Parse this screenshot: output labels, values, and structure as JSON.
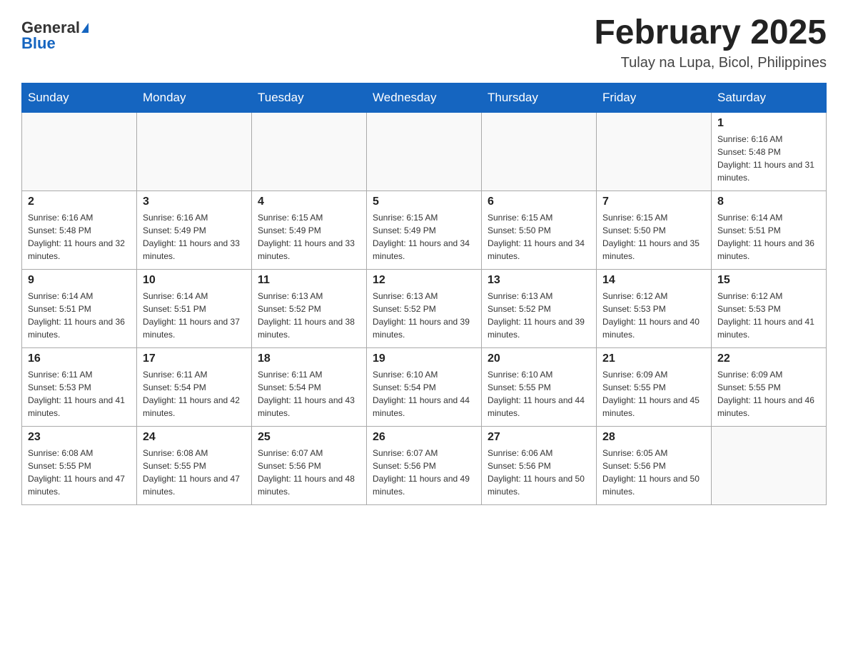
{
  "header": {
    "logo_general": "General",
    "logo_blue": "Blue",
    "month_title": "February 2025",
    "location": "Tulay na Lupa, Bicol, Philippines"
  },
  "days_of_week": [
    "Sunday",
    "Monday",
    "Tuesday",
    "Wednesday",
    "Thursday",
    "Friday",
    "Saturday"
  ],
  "weeks": [
    [
      {
        "day": "",
        "info": []
      },
      {
        "day": "",
        "info": []
      },
      {
        "day": "",
        "info": []
      },
      {
        "day": "",
        "info": []
      },
      {
        "day": "",
        "info": []
      },
      {
        "day": "",
        "info": []
      },
      {
        "day": "1",
        "info": [
          "Sunrise: 6:16 AM",
          "Sunset: 5:48 PM",
          "Daylight: 11 hours and 31 minutes."
        ]
      }
    ],
    [
      {
        "day": "2",
        "info": [
          "Sunrise: 6:16 AM",
          "Sunset: 5:48 PM",
          "Daylight: 11 hours and 32 minutes."
        ]
      },
      {
        "day": "3",
        "info": [
          "Sunrise: 6:16 AM",
          "Sunset: 5:49 PM",
          "Daylight: 11 hours and 33 minutes."
        ]
      },
      {
        "day": "4",
        "info": [
          "Sunrise: 6:15 AM",
          "Sunset: 5:49 PM",
          "Daylight: 11 hours and 33 minutes."
        ]
      },
      {
        "day": "5",
        "info": [
          "Sunrise: 6:15 AM",
          "Sunset: 5:49 PM",
          "Daylight: 11 hours and 34 minutes."
        ]
      },
      {
        "day": "6",
        "info": [
          "Sunrise: 6:15 AM",
          "Sunset: 5:50 PM",
          "Daylight: 11 hours and 34 minutes."
        ]
      },
      {
        "day": "7",
        "info": [
          "Sunrise: 6:15 AM",
          "Sunset: 5:50 PM",
          "Daylight: 11 hours and 35 minutes."
        ]
      },
      {
        "day": "8",
        "info": [
          "Sunrise: 6:14 AM",
          "Sunset: 5:51 PM",
          "Daylight: 11 hours and 36 minutes."
        ]
      }
    ],
    [
      {
        "day": "9",
        "info": [
          "Sunrise: 6:14 AM",
          "Sunset: 5:51 PM",
          "Daylight: 11 hours and 36 minutes."
        ]
      },
      {
        "day": "10",
        "info": [
          "Sunrise: 6:14 AM",
          "Sunset: 5:51 PM",
          "Daylight: 11 hours and 37 minutes."
        ]
      },
      {
        "day": "11",
        "info": [
          "Sunrise: 6:13 AM",
          "Sunset: 5:52 PM",
          "Daylight: 11 hours and 38 minutes."
        ]
      },
      {
        "day": "12",
        "info": [
          "Sunrise: 6:13 AM",
          "Sunset: 5:52 PM",
          "Daylight: 11 hours and 39 minutes."
        ]
      },
      {
        "day": "13",
        "info": [
          "Sunrise: 6:13 AM",
          "Sunset: 5:52 PM",
          "Daylight: 11 hours and 39 minutes."
        ]
      },
      {
        "day": "14",
        "info": [
          "Sunrise: 6:12 AM",
          "Sunset: 5:53 PM",
          "Daylight: 11 hours and 40 minutes."
        ]
      },
      {
        "day": "15",
        "info": [
          "Sunrise: 6:12 AM",
          "Sunset: 5:53 PM",
          "Daylight: 11 hours and 41 minutes."
        ]
      }
    ],
    [
      {
        "day": "16",
        "info": [
          "Sunrise: 6:11 AM",
          "Sunset: 5:53 PM",
          "Daylight: 11 hours and 41 minutes."
        ]
      },
      {
        "day": "17",
        "info": [
          "Sunrise: 6:11 AM",
          "Sunset: 5:54 PM",
          "Daylight: 11 hours and 42 minutes."
        ]
      },
      {
        "day": "18",
        "info": [
          "Sunrise: 6:11 AM",
          "Sunset: 5:54 PM",
          "Daylight: 11 hours and 43 minutes."
        ]
      },
      {
        "day": "19",
        "info": [
          "Sunrise: 6:10 AM",
          "Sunset: 5:54 PM",
          "Daylight: 11 hours and 44 minutes."
        ]
      },
      {
        "day": "20",
        "info": [
          "Sunrise: 6:10 AM",
          "Sunset: 5:55 PM",
          "Daylight: 11 hours and 44 minutes."
        ]
      },
      {
        "day": "21",
        "info": [
          "Sunrise: 6:09 AM",
          "Sunset: 5:55 PM",
          "Daylight: 11 hours and 45 minutes."
        ]
      },
      {
        "day": "22",
        "info": [
          "Sunrise: 6:09 AM",
          "Sunset: 5:55 PM",
          "Daylight: 11 hours and 46 minutes."
        ]
      }
    ],
    [
      {
        "day": "23",
        "info": [
          "Sunrise: 6:08 AM",
          "Sunset: 5:55 PM",
          "Daylight: 11 hours and 47 minutes."
        ]
      },
      {
        "day": "24",
        "info": [
          "Sunrise: 6:08 AM",
          "Sunset: 5:55 PM",
          "Daylight: 11 hours and 47 minutes."
        ]
      },
      {
        "day": "25",
        "info": [
          "Sunrise: 6:07 AM",
          "Sunset: 5:56 PM",
          "Daylight: 11 hours and 48 minutes."
        ]
      },
      {
        "day": "26",
        "info": [
          "Sunrise: 6:07 AM",
          "Sunset: 5:56 PM",
          "Daylight: 11 hours and 49 minutes."
        ]
      },
      {
        "day": "27",
        "info": [
          "Sunrise: 6:06 AM",
          "Sunset: 5:56 PM",
          "Daylight: 11 hours and 50 minutes."
        ]
      },
      {
        "day": "28",
        "info": [
          "Sunrise: 6:05 AM",
          "Sunset: 5:56 PM",
          "Daylight: 11 hours and 50 minutes."
        ]
      },
      {
        "day": "",
        "info": []
      }
    ]
  ]
}
